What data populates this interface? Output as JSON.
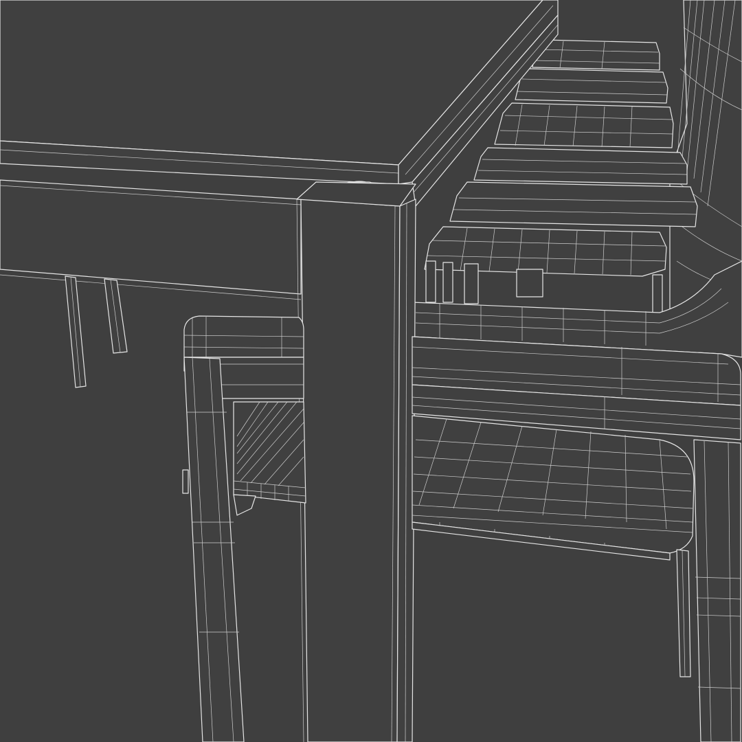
{
  "viewport": {
    "background": "#3f3f3f",
    "wire_color": "#e6e6e6",
    "render_mode": "wireframe",
    "subject": [
      "table",
      "armchair-row"
    ]
  }
}
